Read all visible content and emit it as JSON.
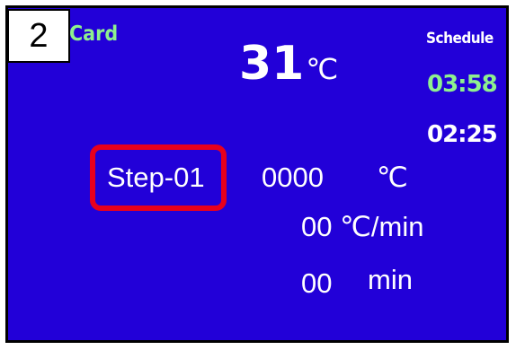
{
  "badge": {
    "number": "2"
  },
  "header": {
    "card_label": "Card",
    "schedule_label": "Schedule"
  },
  "current_temp": {
    "value": "31",
    "unit": "℃"
  },
  "times": {
    "time_1": "03:58",
    "time_2": "02:25"
  },
  "step": {
    "name": "Step-01",
    "target_temp": "0000",
    "target_temp_unit": "℃",
    "rate": "00 ℃/min",
    "hold_value": "00",
    "hold_unit": "min"
  },
  "colors": {
    "background": "#2200d8",
    "accent_green": "#8ef08e",
    "highlight_red": "#e8001c"
  }
}
